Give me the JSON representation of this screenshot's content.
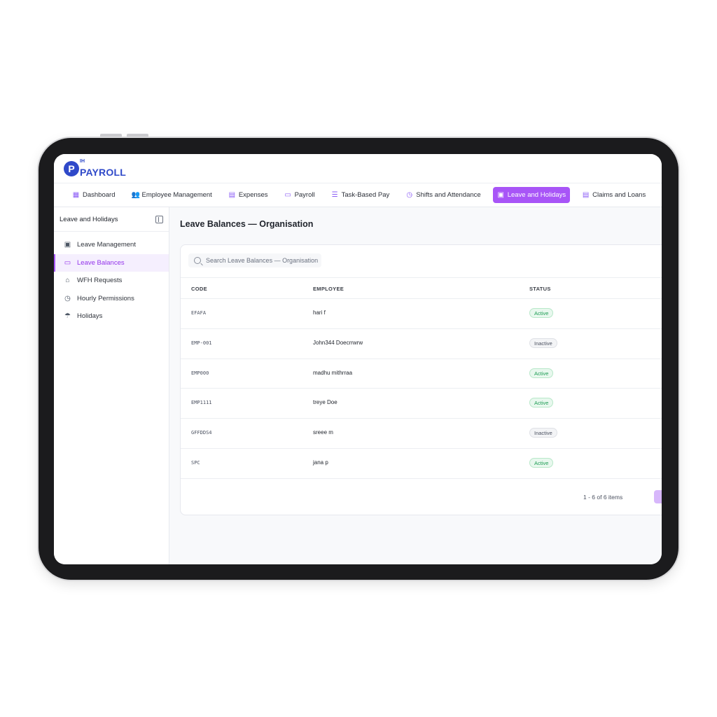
{
  "app": {
    "logo_text": "PAYROLL",
    "logo_prefix": "IH",
    "logo_letter": "P"
  },
  "nav": {
    "items": [
      {
        "label": "Dashboard",
        "icon": "grid-icon",
        "glyph": "▦"
      },
      {
        "label": "Employee Management",
        "icon": "users-icon",
        "glyph": "👥"
      },
      {
        "label": "Expenses",
        "icon": "document-icon",
        "glyph": "▤"
      },
      {
        "label": "Payroll",
        "icon": "wallet-icon",
        "glyph": "▭"
      },
      {
        "label": "Task-Based Pay",
        "icon": "list-icon",
        "glyph": "☰"
      },
      {
        "label": "Shifts and Attendance",
        "icon": "clock-icon",
        "glyph": "◷"
      },
      {
        "label": "Leave and Holidays",
        "icon": "calendar-icon",
        "glyph": "▣",
        "active": true
      },
      {
        "label": "Claims and Loans",
        "icon": "receipt-icon",
        "glyph": "▤"
      }
    ]
  },
  "sidebar": {
    "title": "Leave and Holidays",
    "items": [
      {
        "label": "Leave Management",
        "icon": "calendar-check-icon",
        "glyph": "▣"
      },
      {
        "label": "Leave Balances",
        "icon": "inbox-icon",
        "glyph": "▭",
        "active": true
      },
      {
        "label": "WFH Requests",
        "icon": "home-icon",
        "glyph": "⌂"
      },
      {
        "label": "Hourly Permissions",
        "icon": "clock-icon",
        "glyph": "◷"
      },
      {
        "label": "Holidays",
        "icon": "umbrella-icon",
        "glyph": "☂"
      }
    ]
  },
  "main": {
    "title": "Leave Balances — Organisation",
    "search_placeholder": "Search Leave Balances — Organisation",
    "columns": {
      "code": "CODE",
      "employee": "EMPLOYEE",
      "status": "STATUS"
    },
    "rows": [
      {
        "code": "EFAFA",
        "employee": "hari f",
        "status": "Active"
      },
      {
        "code": "EMP-001",
        "employee": "John344 Doecrrwrw",
        "status": "Inactive"
      },
      {
        "code": "EMP000",
        "employee": "madhu mithrraa",
        "status": "Active"
      },
      {
        "code": "EMP1111",
        "employee": "treye Doe",
        "status": "Active"
      },
      {
        "code": "GFFDDS4",
        "employee": "sreee m",
        "status": "Inactive"
      },
      {
        "code": "SPC",
        "employee": "jana p",
        "status": "Active"
      }
    ],
    "pagination": "1 - 6 of 6 items"
  },
  "colors": {
    "accent": "#a855f7",
    "brand": "#2f49c9",
    "active_green": "#1f9d55"
  }
}
